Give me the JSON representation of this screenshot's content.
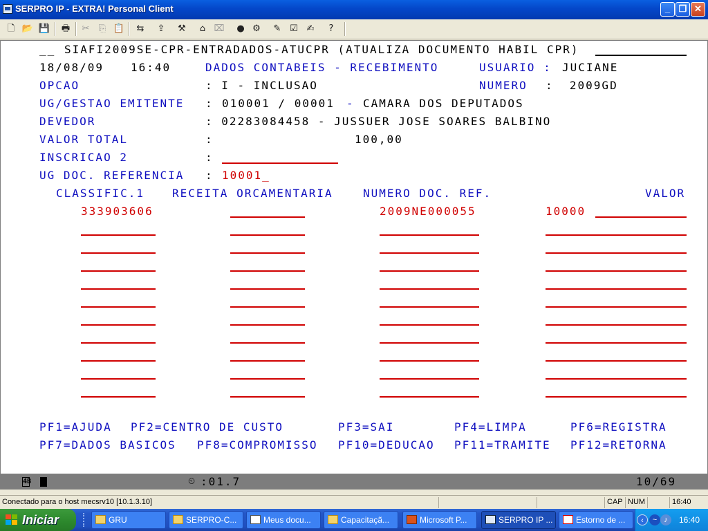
{
  "window": {
    "title": "SERPRO IP - EXTRA! Personal Client",
    "minimize_glyph": "_",
    "maximize_glyph": "❐",
    "close_glyph": "✕"
  },
  "toolbar": {
    "icons": [
      "new-icon",
      "open-icon",
      "save-icon",
      "print-icon",
      "cut-icon",
      "copy-icon",
      "paste-icon",
      "trace-icon",
      "transfer-icon",
      "macro-icon",
      "session-icon",
      "hotspot-icon",
      "record-icon",
      "settings-icon",
      "edit-icon",
      "check-icon",
      "script-icon",
      "help-icon"
    ]
  },
  "screen": {
    "header_prefix": "__",
    "header_title": "SIAFI2009SE-CPR-ENTRADADOS-ATUCPR (ATUALIZA DOCUMENTO HABIL CPR)",
    "date": "18/08/09",
    "time": "16:40",
    "section_title": "DADOS CONTABEIS - RECEBIMENTO",
    "usuario_label": "USUARIO :",
    "usuario_value": "JUCIANE",
    "opcao_label": "OPCAO",
    "opcao_value": ": I - INCLUSAO",
    "numero_label": "NUMERO",
    "numero_value": ":  2009GD",
    "ug_label": "UG/GESTAO EMITENTE",
    "ug_sep": ":",
    "ug_code": "010001 / 00001",
    "ug_dash": "-",
    "ug_name": "CAMARA DOS DEPUTADOS",
    "devedor_label": "DEVEDOR",
    "devedor_value": ": 02283084458 - JUSSUER JOSE SOARES BALBINO",
    "valor_total_label": "VALOR TOTAL",
    "valor_total_sep": ":",
    "valor_total_value": "100,00",
    "inscricao_label": "INSCRICAO 2",
    "inscricao_sep": ":",
    "ug_doc_label": "UG DOC. REFERENCIA",
    "ug_doc_sep": ":",
    "ug_doc_value": "10001_",
    "col_classific": "CLASSIFIC.1",
    "col_receita": "RECEITA ORCAMENTARIA",
    "col_numero_doc": "NUMERO DOC. REF.",
    "col_valor": "VALOR",
    "row1_classific": "333903606",
    "row1_numero_doc": "2009NE000055",
    "row1_valor": "10000",
    "pf_row1": [
      "PF1=AJUDA",
      "PF2=CENTRO DE CUSTO",
      "PF3=SAI",
      "PF4=LIMPA",
      "PF6=REGISTRA"
    ],
    "pf_row2": [
      "PF7=DADOS BASICOS",
      "PF8=COMPROMISSO",
      "PF10=DEDUCAO",
      "PF11=TRAMITE",
      "PF12=RETORNA"
    ]
  },
  "oia": {
    "indicator": "4B",
    "response_time": ":01.7",
    "cursor_pos": "10/69"
  },
  "statusbar": {
    "connection": "Conectado para o host mecsrv10 [10.1.3.10]",
    "caps": "CAP",
    "num": "NUM",
    "clock": "16:40"
  },
  "taskbar": {
    "start_label": "Iniciar",
    "tasks": [
      "GRU",
      "SERPRO-C...",
      "Meus docu...",
      "Capacitaçã...",
      "Microsoft P...",
      "SERPRO IP ...",
      "Estorno de ..."
    ],
    "clock": "16:40"
  }
}
